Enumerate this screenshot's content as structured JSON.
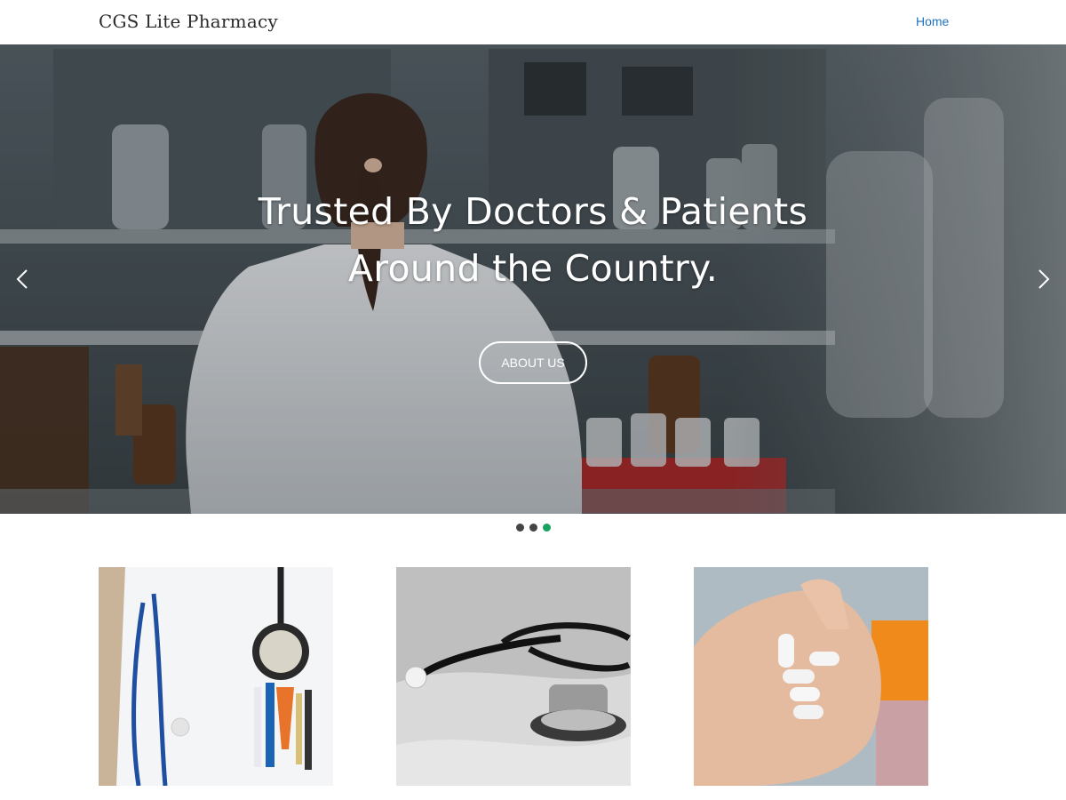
{
  "header": {
    "brand": "CGS Lite Pharmacy",
    "nav": [
      {
        "label": "Home"
      }
    ],
    "accent_color": "#1e73be"
  },
  "hero": {
    "title_line1": "Trusted By Doctors & Patients",
    "title_line2": "Around the Country.",
    "button_label": "ABOUT US",
    "prev_icon": "chevron-left-icon",
    "next_icon": "chevron-right-icon",
    "slide_count": 3,
    "active_slide": 3,
    "active_dot_color": "#1aa260"
  },
  "cards": [
    {
      "image": "doctor-coat-stethoscope-image"
    },
    {
      "image": "stethoscope-image"
    },
    {
      "image": "pills-in-hand-image"
    }
  ]
}
